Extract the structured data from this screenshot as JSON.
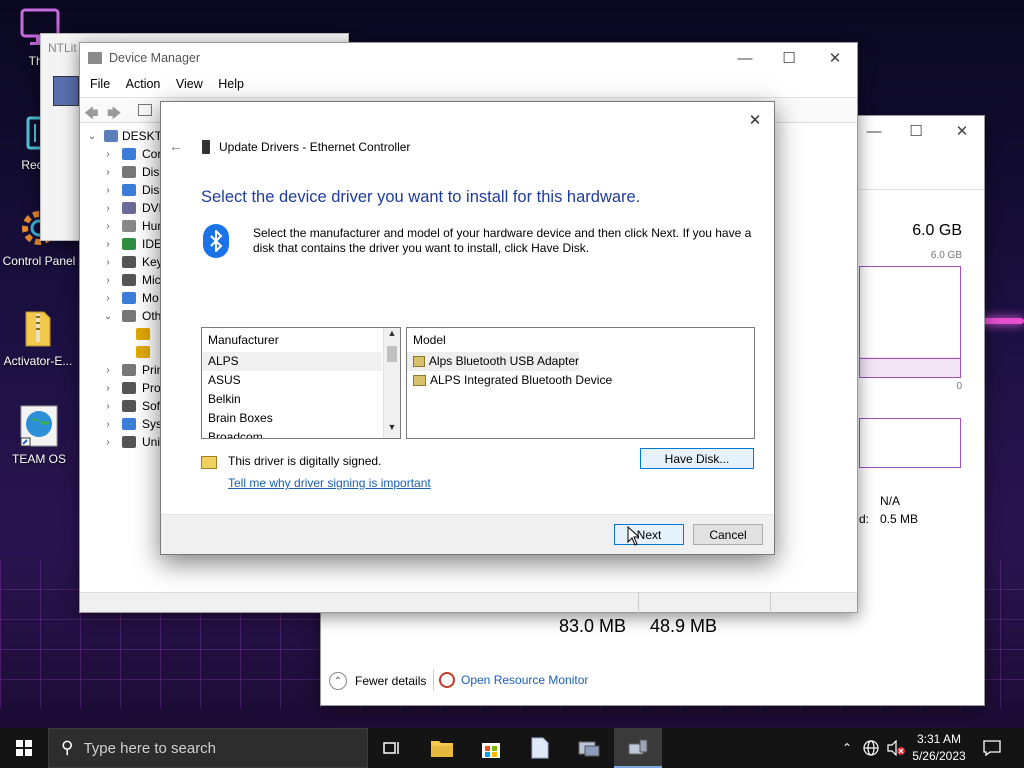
{
  "desktop": {
    "icons": [
      {
        "label": "This",
        "icon": "monitor-icon"
      },
      {
        "label": "Recyc",
        "icon": "recycle-bin-icon"
      },
      {
        "label": "Control Panel",
        "icon": "control-panel-icon"
      },
      {
        "label": "Activator-E...",
        "icon": "zip-folder-icon"
      },
      {
        "label": "TEAM OS",
        "icon": "globe-shortcut-icon"
      }
    ]
  },
  "ntlite": {
    "title": "NTLit"
  },
  "task_manager": {
    "memory_total": "6.0 GB",
    "memory_graph_max": "6.0 GB",
    "memory_graph_min": "0",
    "na_value": "N/A",
    "small_value_label": "d:",
    "small_value": "0.5 MB",
    "value_1": "83.0 MB",
    "value_2": "48.9 MB",
    "fewer_details": "Fewer details",
    "open_resource_monitor": "Open Resource Monitor"
  },
  "device_manager": {
    "title": "Device Manager",
    "menu": [
      "File",
      "Action",
      "View",
      "Help"
    ],
    "root": "DESKTO",
    "tree": [
      {
        "label": "Cor",
        "expanded": false,
        "color": "#3b7dd8"
      },
      {
        "label": "Disl",
        "expanded": false,
        "color": "#777777"
      },
      {
        "label": "Disp",
        "expanded": false,
        "color": "#3b7dd8"
      },
      {
        "label": "DVD",
        "expanded": false,
        "color": "#6a6a9a"
      },
      {
        "label": "Hun",
        "expanded": false,
        "color": "#888888"
      },
      {
        "label": "IDE",
        "expanded": false,
        "color": "#2f8f3f"
      },
      {
        "label": "Key",
        "expanded": false,
        "color": "#555555"
      },
      {
        "label": "Mic",
        "expanded": false,
        "color": "#555555"
      },
      {
        "label": "Mo",
        "expanded": false,
        "color": "#3b7dd8"
      },
      {
        "label": "Oth",
        "expanded": true,
        "color": "#777777"
      },
      {
        "label": "",
        "expanded": null,
        "color": "#e0a800"
      },
      {
        "label": "",
        "expanded": null,
        "color": "#e0a800"
      },
      {
        "label": "Prin",
        "expanded": false,
        "color": "#777777"
      },
      {
        "label": "Pro",
        "expanded": false,
        "color": "#555555"
      },
      {
        "label": "Soft",
        "expanded": false,
        "color": "#555555"
      },
      {
        "label": "Syst",
        "expanded": false,
        "color": "#3b7dd8"
      },
      {
        "label": "Uni",
        "expanded": false,
        "color": "#555555"
      }
    ]
  },
  "dialog": {
    "title": "Update Drivers - Ethernet Controller",
    "heading": "Select the device driver you want to install for this hardware.",
    "description": "Select the manufacturer and model of your hardware device and then click Next. If you have a disk that contains the driver you want to install, click Have Disk.",
    "manufacturer_header": "Manufacturer",
    "manufacturers": [
      "ALPS",
      "ASUS",
      "Belkin",
      "Brain Boxes",
      "Broadcom"
    ],
    "selected_manufacturer": "ALPS",
    "model_header": "Model",
    "models": [
      "Alps Bluetooth USB Adapter",
      "ALPS Integrated Bluetooth Device"
    ],
    "selected_model": "Alps Bluetooth USB Adapter",
    "signed_text": "This driver is digitally signed.",
    "signing_link": "Tell me why driver signing is important",
    "have_disk": "Have Disk...",
    "next": "Next",
    "cancel": "Cancel"
  },
  "taskbar": {
    "search_placeholder": "Type here to search",
    "time": "3:31 AM",
    "date": "5/26/2023"
  }
}
